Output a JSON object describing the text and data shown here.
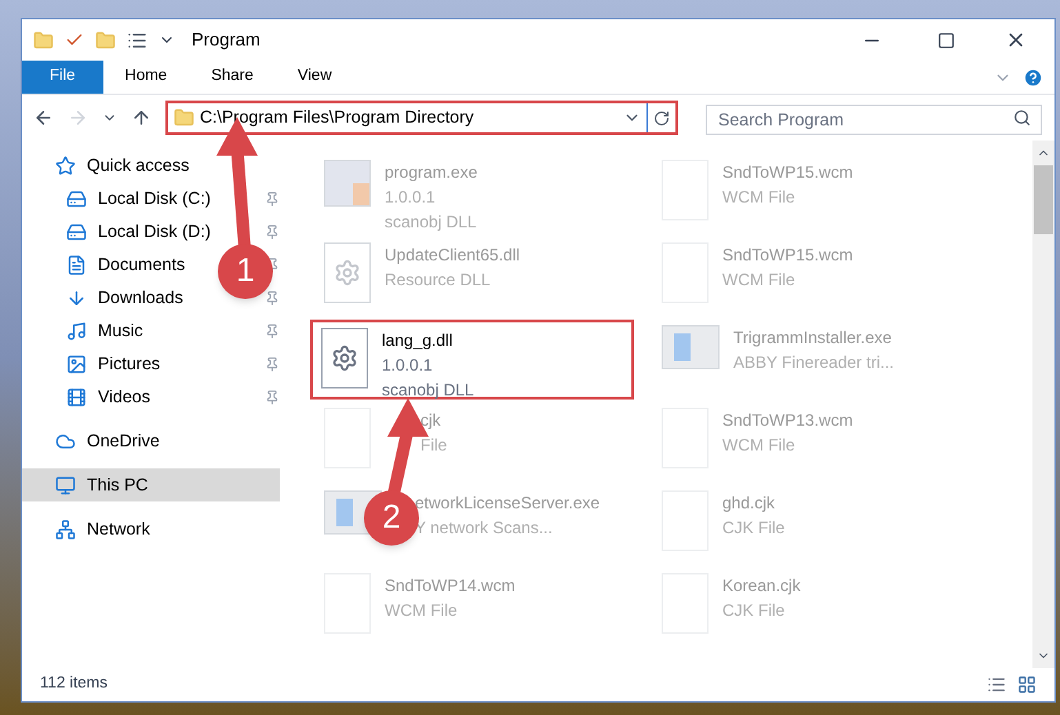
{
  "window": {
    "title": "Program"
  },
  "ribbon": {
    "tabs": [
      {
        "label": "File",
        "selected": true
      },
      {
        "label": "Home",
        "selected": false
      },
      {
        "label": "Share",
        "selected": false
      },
      {
        "label": "View",
        "selected": false
      }
    ]
  },
  "address": {
    "path": "C:\\Program Files\\Program Directory"
  },
  "search": {
    "placeholder": "Search Program"
  },
  "sidebar": {
    "items": [
      {
        "label": "Quick access",
        "selected": false,
        "children": [
          {
            "label": "Local Disk (C:)",
            "pinned": true,
            "selected": false
          },
          {
            "label": "Local Disk (D:)",
            "pinned": true,
            "selected": false
          },
          {
            "label": "Documents",
            "pinned": true,
            "selected": false
          },
          {
            "label": "Downloads",
            "pinned": true,
            "selected": false
          },
          {
            "label": "Music",
            "pinned": true,
            "selected": false
          },
          {
            "label": "Pictures",
            "pinned": true,
            "selected": false
          },
          {
            "label": "Videos",
            "pinned": true,
            "selected": false
          }
        ]
      },
      {
        "label": "OneDrive",
        "selected": false
      },
      {
        "label": "This PC",
        "selected": true
      },
      {
        "label": "Network",
        "selected": false
      }
    ]
  },
  "files": [
    {
      "kind": "exe",
      "name": "program.exe",
      "details": [
        "1.0.0.1",
        "scanobj DLL"
      ],
      "highlighted": false
    },
    {
      "kind": "file",
      "name": "SndToWP15.wcm",
      "details": [
        "WCM File"
      ],
      "highlighted": false
    },
    {
      "kind": "dll",
      "name": "UpdateClient65.dll",
      "details": [
        "Resource DLL"
      ],
      "highlighted": false
    },
    {
      "kind": "file",
      "name": "SndToWP15.wcm",
      "details": [
        "WCM File"
      ],
      "highlighted": false
    },
    {
      "kind": "dll",
      "name": "lang_g.dll",
      "details": [
        "1.0.0.1",
        "scanobj DLL"
      ],
      "highlighted": true
    },
    {
      "kind": "setup",
      "name": "TrigrammInstaller.exe",
      "details": [
        "ABBY Finereader tri..."
      ],
      "highlighted": false
    },
    {
      "kind": "file",
      "name": "cjk",
      "details": [
        "File"
      ],
      "highlighted": false
    },
    {
      "kind": "file",
      "name": "SndToWP13.wcm",
      "details": [
        "WCM File"
      ],
      "highlighted": false
    },
    {
      "kind": "setup",
      "name": "etworkLicenseServer.exe",
      "details": [
        "Y network Scans..."
      ],
      "highlighted": false
    },
    {
      "kind": "file",
      "name": "ghd.cjk",
      "details": [
        "CJK File"
      ],
      "highlighted": false
    },
    {
      "kind": "file",
      "name": "SndToWP14.wcm",
      "details": [
        "WCM File"
      ],
      "highlighted": false
    },
    {
      "kind": "file",
      "name": "Korean.cjk",
      "details": [
        "CJK File"
      ],
      "highlighted": false
    }
  ],
  "status_bar": {
    "count": "112 items"
  },
  "annotations": [
    {
      "label": "1"
    },
    {
      "label": "2"
    }
  ]
}
